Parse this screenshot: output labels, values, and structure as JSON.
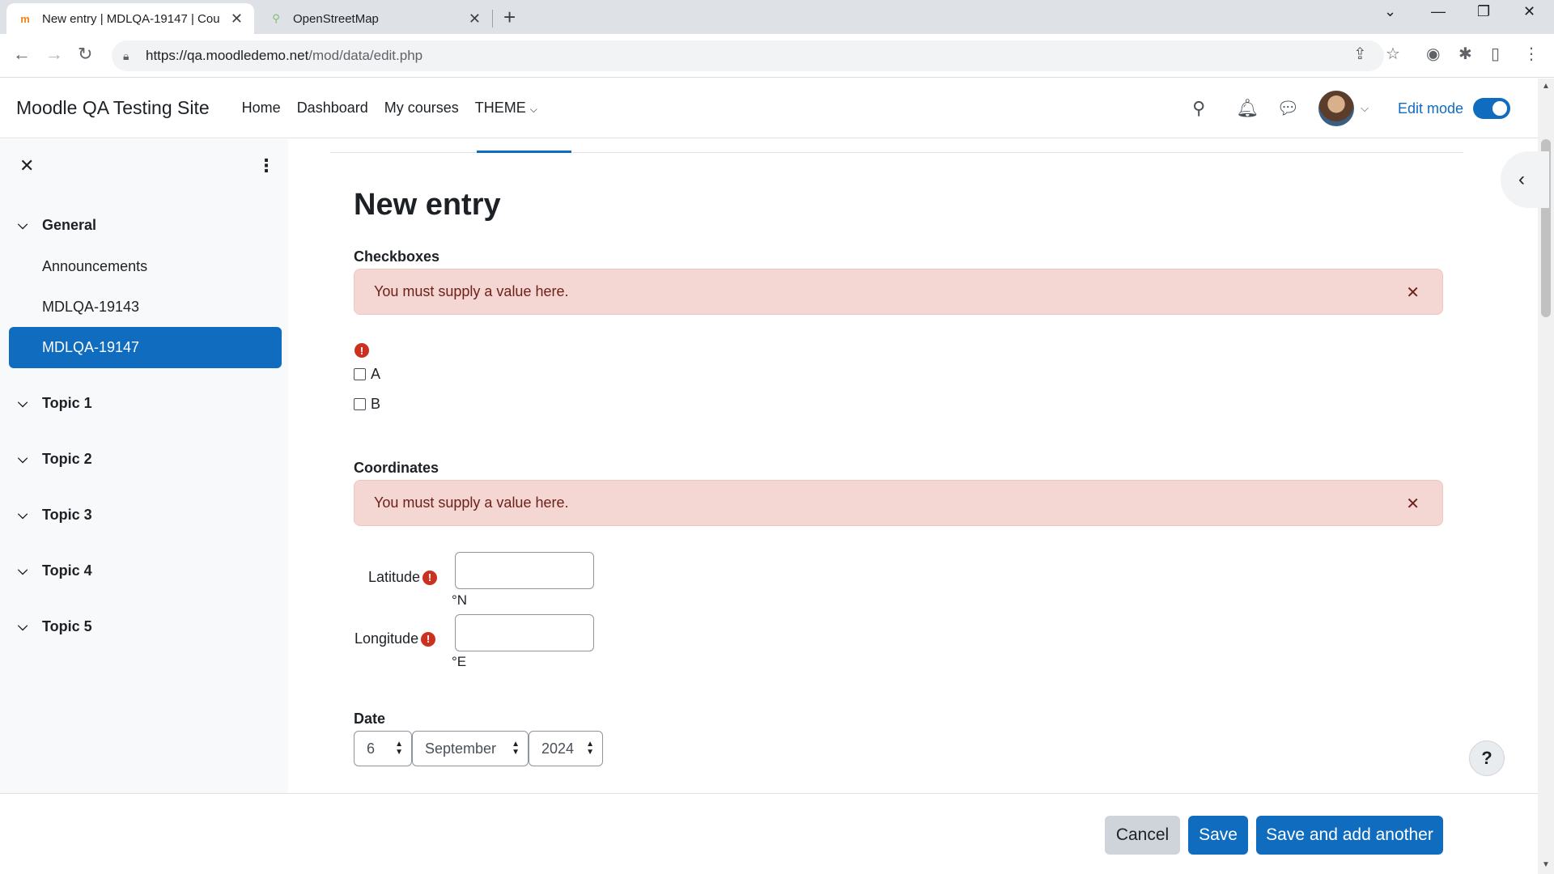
{
  "browser": {
    "tabs": [
      {
        "title": "New entry | MDLQA-19147 | Cou",
        "active": true
      },
      {
        "title": "OpenStreetMap",
        "active": false
      }
    ],
    "url_host": "https://qa.moodledemo.net",
    "url_path": "/mod/data/edit.php"
  },
  "navbar": {
    "brand": "Moodle QA Testing Site",
    "links": [
      "Home",
      "Dashboard",
      "My courses",
      "THEME"
    ],
    "edit_mode_label": "Edit mode"
  },
  "course_index": {
    "sections": [
      {
        "label": "General",
        "items": [
          "Announcements",
          "MDLQA-19143",
          "MDLQA-19147"
        ],
        "active_item": "MDLQA-19147"
      },
      {
        "label": "Topic 1"
      },
      {
        "label": "Topic 2"
      },
      {
        "label": "Topic 3"
      },
      {
        "label": "Topic 4"
      },
      {
        "label": "Topic 5"
      }
    ]
  },
  "form": {
    "title": "New entry",
    "checkboxes": {
      "label": "Checkboxes",
      "error": "You must supply a value here.",
      "options": [
        {
          "label": "A",
          "checked": false
        },
        {
          "label": "B",
          "checked": false
        }
      ]
    },
    "coordinates": {
      "label": "Coordinates",
      "error": "You must supply a value here.",
      "latitude_label": "Latitude",
      "latitude_value": "",
      "latitude_unit": "°N",
      "longitude_label": "Longitude",
      "longitude_value": "",
      "longitude_unit": "°E"
    },
    "date": {
      "label": "Date",
      "day": "6",
      "month": "September",
      "year": "2024"
    }
  },
  "footer": {
    "cancel": "Cancel",
    "save": "Save",
    "save_add": "Save and add another"
  },
  "help_label": "?",
  "colors": {
    "primary": "#0f6cbf",
    "error_bg": "#f4d6d2",
    "error_text": "#6e211a",
    "error_icon": "#ca3120"
  }
}
